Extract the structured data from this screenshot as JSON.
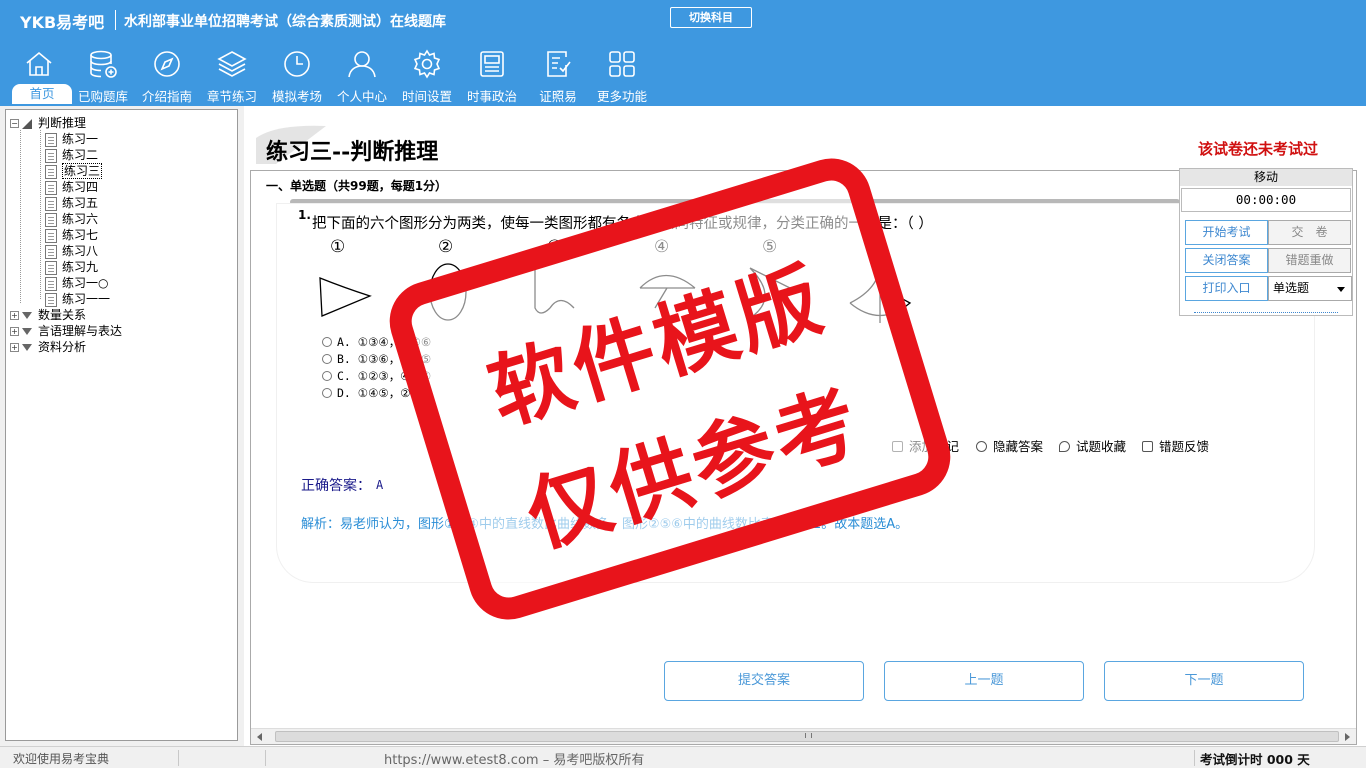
{
  "header": {
    "logo": "YKB易考吧",
    "title": "水利部事业单位招聘考试（综合素质测试）在线题库",
    "switch_subject": "切换科目",
    "nav": [
      {
        "label": "首页",
        "icon": "home-icon",
        "active": true
      },
      {
        "label": "已购题库",
        "icon": "database-icon"
      },
      {
        "label": "介绍指南",
        "icon": "compass-icon"
      },
      {
        "label": "章节练习",
        "icon": "layers-icon"
      },
      {
        "label": "模拟考场",
        "icon": "clock-icon"
      },
      {
        "label": "个人中心",
        "icon": "user-icon"
      },
      {
        "label": "时间设置",
        "icon": "gear-icon"
      },
      {
        "label": "时事政治",
        "icon": "newspaper-icon"
      },
      {
        "label": "证照易",
        "icon": "checklist-icon"
      },
      {
        "label": "更多功能",
        "icon": "grid-icon"
      }
    ]
  },
  "tree": {
    "root_open": "判断推理",
    "children": [
      "练习一",
      "练习二",
      "练习三",
      "练习四",
      "练习五",
      "练习六",
      "练习七",
      "练习八",
      "练习九",
      "练习一○",
      "练习一一"
    ],
    "selected": "练习三",
    "collapsed": [
      "数量关系",
      "言语理解与表达",
      "资料分析"
    ]
  },
  "main": {
    "title": "练习三--判断推理",
    "exam_status": "该试卷还未考试过",
    "section_header": "一、单选题（共99题，每题1分）",
    "question": {
      "number": "1.",
      "text": "把下面的六个图形分为两类，使每一类图形都有各自的共同特征或规律，分类正确的一项是：（   ）",
      "figure_numbers": [
        "①",
        "②",
        "③",
        "④",
        "⑤",
        "⑥"
      ],
      "options": [
        {
          "letter": "A.",
          "text": "①③④，②⑤⑥"
        },
        {
          "letter": "B.",
          "text": "①③⑥，②④⑤"
        },
        {
          "letter": "C.",
          "text": "①②③，④⑤⑥"
        },
        {
          "letter": "D.",
          "text": "①④⑤，②③⑥"
        }
      ]
    },
    "tools": [
      "添加笔记",
      "隐藏答案",
      "试题收藏",
      "错题反馈"
    ],
    "answer_label": "正确答案：",
    "answer_value": "A",
    "analysis": "解析：易老师认为，图形①③④中的直线数比曲线数多，图形②⑤⑥中的曲线数比直线数多1。故本题选A。",
    "buttons": {
      "submit": "提交答案",
      "prev": "上一题",
      "next": "下一题"
    }
  },
  "control_panel": {
    "move_label": "移动",
    "timer": "00:00:00",
    "start_exam": "开始考试",
    "hand_in": "交　卷",
    "close_answer": "关闭答案",
    "redo_wrong": "错题重做",
    "print_entry": "打印入口",
    "question_type": "单选题"
  },
  "status_bar": {
    "welcome": "欢迎使用易考宝典",
    "copyright": "https://www.etest8.com – 易考吧版权所有",
    "countdown": "考试倒计时 000 天"
  },
  "watermark": {
    "line1": "软件模版",
    "line2": "仅供参考",
    "color": "#e8141b"
  },
  "colors": {
    "header_bg": "#3e98e0",
    "accent_red": "#d01010",
    "link_blue": "#2b8ed6"
  }
}
